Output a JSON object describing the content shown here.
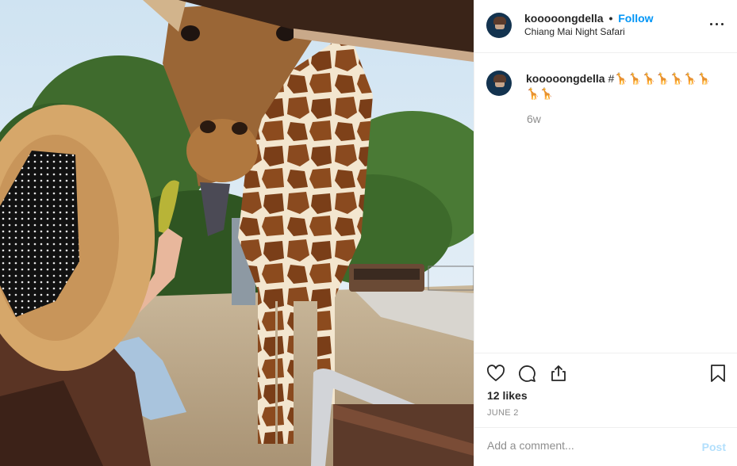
{
  "photo": {
    "description_icon": "photo"
  },
  "header": {
    "username": "kooooongdella",
    "separator": "•",
    "follow_label": "Follow",
    "location": "Chiang Mai Night Safari",
    "more_icon": "more-horizontal-icon"
  },
  "caption": {
    "username": "kooooongdella",
    "text": "#🦒🦒🦒🦒🦒🦒🦒🦒🦒",
    "time": "6w"
  },
  "actions": {
    "like_icon": "heart-icon",
    "comment_icon": "comment-icon",
    "share_icon": "share-icon",
    "save_icon": "bookmark-icon",
    "likes": "12 likes",
    "date": "JUNE 2"
  },
  "add_comment": {
    "placeholder": "Add a comment...",
    "post_label": "Post",
    "post_color": "#b2dffc"
  },
  "colors": {
    "follow": "#0095f6",
    "muted": "#8e8e8e",
    "text": "#262626"
  }
}
